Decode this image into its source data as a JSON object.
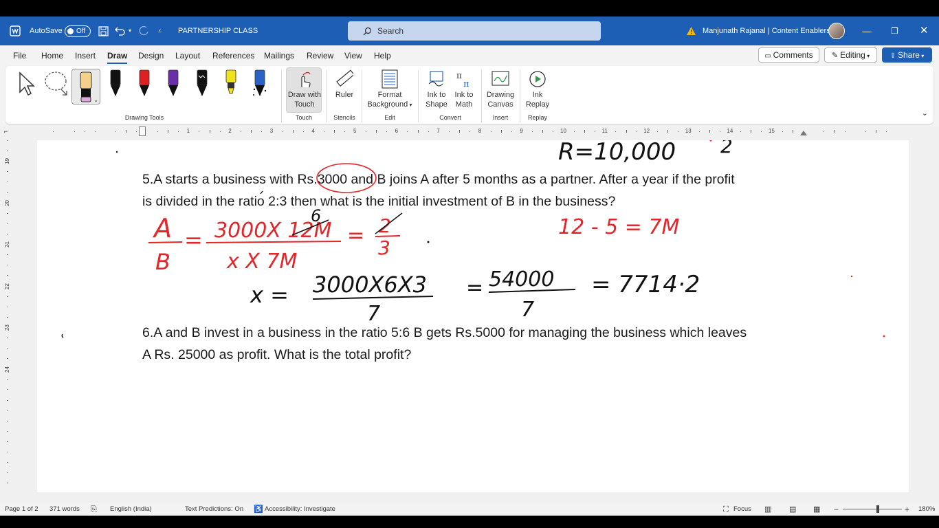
{
  "titlebar": {
    "autosave_label": "AutoSave",
    "autosave_state": "Off",
    "doc_title": "PARTNERSHIP CLASS",
    "search_placeholder": "Search",
    "user_name": "Manjunath Rajanal | Content Enablers"
  },
  "menu": {
    "tabs": [
      "File",
      "Home",
      "Insert",
      "Draw",
      "Design",
      "Layout",
      "References",
      "Mailings",
      "Review",
      "View",
      "Help"
    ],
    "active": "Draw",
    "comments": "Comments",
    "editing": "Editing",
    "share": "Share"
  },
  "ribbon": {
    "groups": {
      "drawing_tools": "Drawing Tools",
      "touch": "Touch",
      "stencils": "Stencils",
      "edit": "Edit",
      "convert": "Convert",
      "insert": "Insert",
      "replay": "Replay"
    },
    "buttons": {
      "draw_with_touch": [
        "Draw with",
        "Touch"
      ],
      "ruler": "Ruler",
      "format_background": [
        "Format",
        "Background"
      ],
      "ink_to_shape": [
        "Ink to",
        "Shape"
      ],
      "ink_to_math": [
        "Ink to",
        "Math"
      ],
      "drawing_canvas": [
        "Drawing",
        "Canvas"
      ],
      "ink_replay": [
        "Ink",
        "Replay"
      ]
    },
    "pen_colors": [
      "#111111",
      "#e02020",
      "#6a2fa8",
      "#111111",
      "#f2e21b",
      "#2a63c8"
    ]
  },
  "ruler": {
    "numbers": [
      "1",
      "2",
      "3",
      "4",
      "5",
      "6",
      "7",
      "8",
      "9",
      "10",
      "11",
      "12",
      "13",
      "14",
      "15"
    ],
    "vertical": [
      "19",
      "20",
      "21",
      "22",
      "23",
      "24"
    ]
  },
  "document": {
    "q5_line1": "5.A starts a business with Rs.3000 and B joins A after 5 months as a partner. After a year if the profit",
    "q5_line2": "is divided in the ratio 2:3 then what is the initial investment of B in the business?",
    "q6_line1": "6.A and B invest in a business in the ratio 5:6 B gets Rs.5000 for managing the business which leaves",
    "q6_line2": "A Rs. 25000 as profit. What is the total profit?",
    "ink": {
      "top_right": "R=10,000",
      "top_right2": "2",
      "eq_left_a": "A",
      "eq_left_b": "B",
      "eq_num": "3000X 12M",
      "eq_num_fix": "6",
      "eq_den": "x X 7M",
      "eq_right_num": "2",
      "eq_right_den": "3",
      "months": "12 - 5 = 7M",
      "solve_x": "x =",
      "solve_num": "3000X6X3",
      "solve_den": "7",
      "solve_mid_num": "54000",
      "solve_mid_den": "7",
      "solve_result": "= 7714·2"
    },
    "colors": {
      "ink_red": "#e2262a",
      "ink_black": "#111111"
    }
  },
  "status": {
    "page": "Page 1 of 2",
    "words": "371 words",
    "language": "English (India)",
    "predictions": "Text Predictions: On",
    "accessibility": "Accessibility: Investigate",
    "focus": "Focus",
    "zoom": "180%"
  }
}
